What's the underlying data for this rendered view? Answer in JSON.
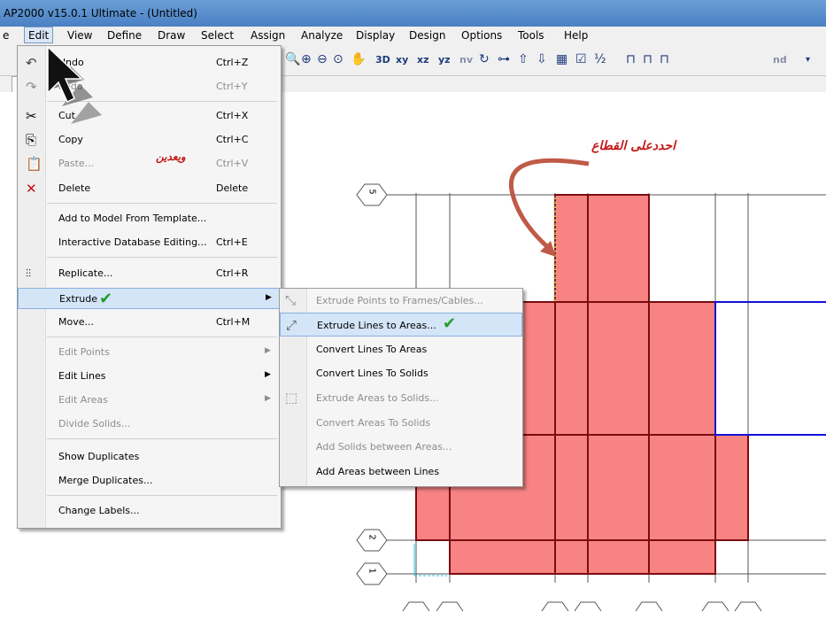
{
  "title": "AP2000 v15.0.1 Ultimate  - (Untitled)",
  "menubar": [
    "e",
    "Edit",
    "View",
    "Define",
    "Draw",
    "Select",
    "Assign",
    "Analyze",
    "Display",
    "Design",
    "Options",
    "Tools",
    "Help"
  ],
  "toolbar": {
    "xy": "xy",
    "xz": "xz",
    "yz": "yz",
    "nv": "nv",
    "nd": "nd"
  },
  "edit_menu": {
    "undo": {
      "label": "Undo",
      "shortcut": "Ctrl+Z"
    },
    "redo": {
      "label": "Redo",
      "shortcut": "Ctrl+Y"
    },
    "cut": {
      "label": "Cut",
      "shortcut": "Ctrl+X"
    },
    "copy": {
      "label": "Copy",
      "shortcut": "Ctrl+C"
    },
    "paste": {
      "label": "Paste...",
      "shortcut": "Ctrl+V"
    },
    "delete": {
      "label": "Delete",
      "shortcut": "Delete"
    },
    "add_template": {
      "label": "Add to Model From Template..."
    },
    "db_editing": {
      "label": "Interactive Database Editing...",
      "shortcut": "Ctrl+E"
    },
    "replicate": {
      "label": "Replicate...",
      "shortcut": "Ctrl+R"
    },
    "extrude": {
      "label": "Extrude"
    },
    "move": {
      "label": "Move...",
      "shortcut": "Ctrl+M"
    },
    "edit_points": {
      "label": "Edit Points"
    },
    "edit_lines": {
      "label": "Edit Lines"
    },
    "edit_areas": {
      "label": "Edit Areas"
    },
    "divide_solids": {
      "label": "Divide Solids..."
    },
    "show_duplicates": {
      "label": "Show Duplicates"
    },
    "merge_duplicates": {
      "label": "Merge Duplicates..."
    },
    "change_labels": {
      "label": "Change Labels..."
    }
  },
  "extrude_submenu": [
    {
      "label": "Extrude Points to Frames/Cables...",
      "enabled": false
    },
    {
      "label": "Extrude Lines to Areas...",
      "enabled": true
    },
    {
      "label": "Convert Lines To Areas",
      "enabled": true
    },
    {
      "label": "Convert Lines To Solids",
      "enabled": true
    },
    {
      "label": "Extrude Areas to Solids...",
      "enabled": false
    },
    {
      "label": "Convert Areas To Solids",
      "enabled": false
    },
    {
      "label": "Add Solids between Areas...",
      "enabled": false
    },
    {
      "label": "Add Areas between Lines",
      "enabled": true
    }
  ],
  "annotations": {
    "cursor_note": "ويعدين",
    "section_note": "احددعلى القطاع"
  },
  "grid_bubbles": [
    "5",
    "2",
    "1"
  ],
  "colors": {
    "area_fill": "#f78383",
    "area_edge": "#7a0c10",
    "selected_line": "#1212d8",
    "grid_line": "#555555",
    "check": "#22a02a",
    "annotation": "#c41a1a"
  }
}
